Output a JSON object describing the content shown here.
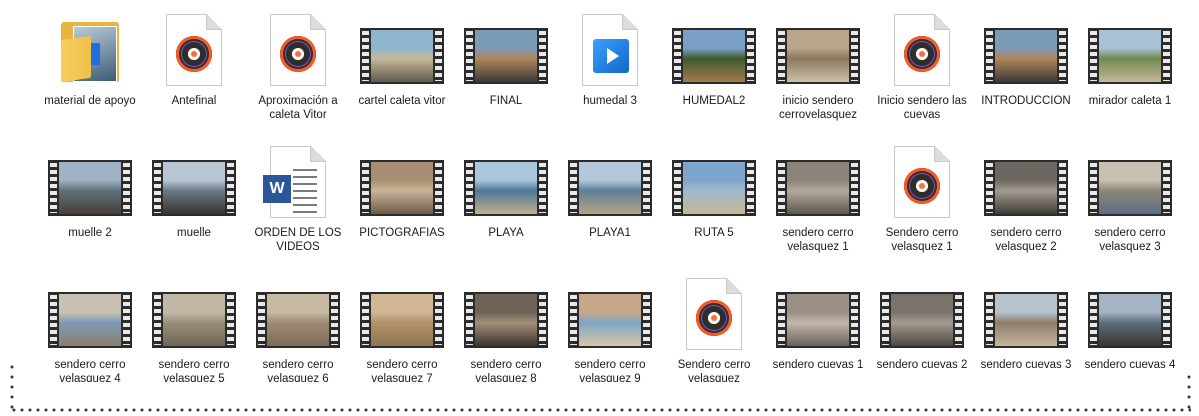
{
  "files": [
    {
      "name": "material de apoyo",
      "kind": "folder",
      "icon": "folder-icon"
    },
    {
      "name": "Antefinal",
      "kind": "media",
      "icon": "media-file-icon"
    },
    {
      "name": "Aproximación a caleta Vitor",
      "kind": "media",
      "icon": "media-file-icon"
    },
    {
      "name": "cartel caleta vitor",
      "kind": "video",
      "icon": "video-thumbnail-icon",
      "colors": [
        "#8fb4cf",
        "#c7b89a",
        "#5f5a4e"
      ]
    },
    {
      "name": "FINAL",
      "kind": "video",
      "icon": "video-thumbnail-icon",
      "colors": [
        "#7a9ab8",
        "#b0865a",
        "#3b3a3a"
      ]
    },
    {
      "name": "humedal 3",
      "kind": "videoapp",
      "icon": "video-player-icon"
    },
    {
      "name": "HUMEDAL2",
      "kind": "video",
      "icon": "video-thumbnail-icon",
      "colors": [
        "#7aa0c6",
        "#3f5a2e",
        "#a27a4e"
      ]
    },
    {
      "name": "inicio sendero cerrovelasquez",
      "kind": "video",
      "icon": "video-thumbnail-icon",
      "colors": [
        "#b9a58a",
        "#8a7860",
        "#d0c0a8"
      ]
    },
    {
      "name": "Inicio sendero las cuevas",
      "kind": "media",
      "icon": "media-file-icon"
    },
    {
      "name": "INTRODUCCION",
      "kind": "video",
      "icon": "video-thumbnail-icon",
      "colors": [
        "#7a9ab8",
        "#b0865a",
        "#3b3a3a"
      ]
    },
    {
      "name": "mirador caleta 1",
      "kind": "video",
      "icon": "video-thumbnail-icon",
      "colors": [
        "#a9c2d6",
        "#6f8a4e",
        "#c8b69a"
      ]
    },
    {
      "name": "muelle 2",
      "kind": "video",
      "icon": "video-thumbnail-icon",
      "colors": [
        "#9fb3c4",
        "#5f6f7a",
        "#4a3f38"
      ]
    },
    {
      "name": "muelle",
      "kind": "video",
      "icon": "video-thumbnail-icon",
      "colors": [
        "#b7c6d2",
        "#6a7a86",
        "#3a342f"
      ]
    },
    {
      "name": "ORDEN DE LOS VIDEOS",
      "kind": "word",
      "icon": "word-document-icon"
    },
    {
      "name": "PICTOGRAFIAS",
      "kind": "video",
      "icon": "video-thumbnail-icon",
      "colors": [
        "#a88e72",
        "#c9b49a",
        "#6e5a48"
      ]
    },
    {
      "name": "PLAYA",
      "kind": "video",
      "icon": "video-thumbnail-icon",
      "colors": [
        "#a8c6dc",
        "#4c7898",
        "#c2ad8e"
      ]
    },
    {
      "name": "PLAYA1",
      "kind": "video",
      "icon": "video-thumbnail-icon",
      "colors": [
        "#b3c8d8",
        "#5d7f98",
        "#b8a484"
      ]
    },
    {
      "name": "RUTA 5",
      "kind": "video",
      "icon": "video-thumbnail-icon",
      "colors": [
        "#7ea6cc",
        "#9fb9cf",
        "#c8b694"
      ]
    },
    {
      "name": "sendero cerro velasquez 1",
      "kind": "video",
      "icon": "video-thumbnail-icon",
      "colors": [
        "#8c8478",
        "#b4aa9a",
        "#5c5650"
      ]
    },
    {
      "name": "Sendero cerro velasquez 1",
      "kind": "media",
      "icon": "media-file-icon"
    },
    {
      "name": "sendero cerro velasquez 2",
      "kind": "video",
      "icon": "video-thumbnail-icon",
      "colors": [
        "#6c6760",
        "#a39c90",
        "#3e3a36"
      ]
    },
    {
      "name": "sendero cerro velasquez 3",
      "kind": "video",
      "icon": "video-thumbnail-icon",
      "colors": [
        "#c8c0b0",
        "#8e8676",
        "#5a6f84"
      ]
    },
    {
      "name": "sendero cerro velasquez 4",
      "kind": "video",
      "icon": "video-thumbnail-icon",
      "colors": [
        "#c9c2b4",
        "#7f9ab5",
        "#8a7f6e"
      ]
    },
    {
      "name": "sendero cerro velasquez 5",
      "kind": "video",
      "icon": "video-thumbnail-icon",
      "colors": [
        "#c2b8a6",
        "#9a8e7a",
        "#6f6656"
      ]
    },
    {
      "name": "sendero cerro velasquez 6",
      "kind": "video",
      "icon": "video-thumbnail-icon",
      "colors": [
        "#c8b9a2",
        "#9e8d74",
        "#7b6c58"
      ]
    },
    {
      "name": "sendero cerro velasquez 7",
      "kind": "video",
      "icon": "video-thumbnail-icon",
      "colors": [
        "#d1b796",
        "#b0926a",
        "#8f7454"
      ]
    },
    {
      "name": "sendero cerro velasquez 8",
      "kind": "video",
      "icon": "video-thumbnail-icon",
      "colors": [
        "#6e6256",
        "#a28e78",
        "#3c342e"
      ]
    },
    {
      "name": "sendero cerro velasquez 9",
      "kind": "video",
      "icon": "video-thumbnail-icon",
      "colors": [
        "#c6a88a",
        "#7fa6c4",
        "#d8c6aa"
      ]
    },
    {
      "name": "Sendero cerro velasquez",
      "kind": "media",
      "icon": "media-file-icon"
    },
    {
      "name": "sendero cuevas 1",
      "kind": "video",
      "icon": "video-thumbnail-icon",
      "colors": [
        "#9a8f84",
        "#c2b8aa",
        "#6a625a"
      ]
    },
    {
      "name": "sendero cuevas 2",
      "kind": "video",
      "icon": "video-thumbnail-icon",
      "colors": [
        "#7a736c",
        "#a49b90",
        "#4c4742"
      ]
    },
    {
      "name": "sendero cuevas 3",
      "kind": "video",
      "icon": "video-thumbnail-icon",
      "colors": [
        "#b7c4ce",
        "#8c7c6a",
        "#c6b69e"
      ]
    },
    {
      "name": "sendero cuevas 4",
      "kind": "video",
      "icon": "video-thumbnail-icon",
      "colors": [
        "#a4b4c2",
        "#5e6e7a",
        "#3a3430"
      ]
    }
  ]
}
